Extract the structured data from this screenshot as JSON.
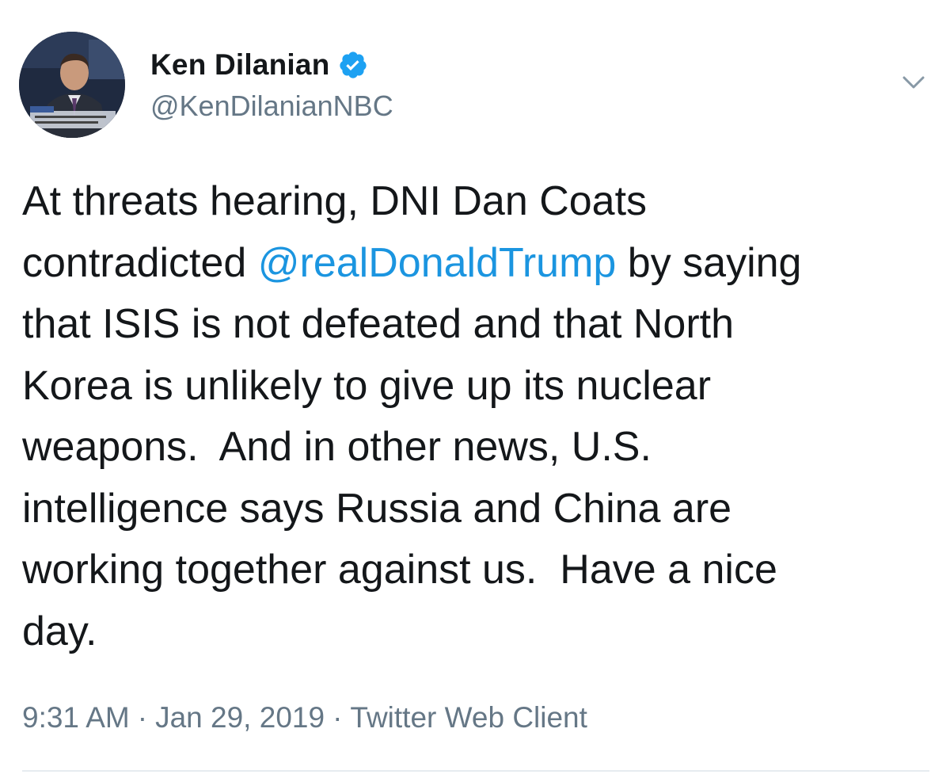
{
  "author": {
    "display_name": "Ken Dilanian",
    "handle": "@KenDilanianNBC",
    "verified": true,
    "avatar_icon": "profile-photo"
  },
  "tweet": {
    "lines": [
      {
        "parts": [
          {
            "text": "At threats hearing, DNI Dan Coats"
          }
        ]
      },
      {
        "parts": [
          {
            "text": "contradicted "
          },
          {
            "text": "@realDonaldTrump",
            "mention": true
          },
          {
            "text": " by saying"
          }
        ]
      },
      {
        "parts": [
          {
            "text": "that ISIS is not defeated and that North"
          }
        ]
      },
      {
        "parts": [
          {
            "text": "Korea is unlikely to give up its nuclear"
          }
        ]
      },
      {
        "parts": [
          {
            "text": "weapons.  And in other news, U.S."
          }
        ]
      },
      {
        "parts": [
          {
            "text": "intelligence says Russia and China are"
          }
        ]
      },
      {
        "parts": [
          {
            "text": "working together against us.  Have a nice"
          }
        ]
      },
      {
        "parts": [
          {
            "text": "day."
          }
        ]
      }
    ],
    "mention_color": "#1b95e0"
  },
  "meta": {
    "time": "9:31 AM",
    "separator": "·",
    "date": "Jan 29, 2019",
    "client": "Twitter Web Client"
  },
  "icons": {
    "verified": "verified-badge-icon",
    "more": "chevron-down-icon"
  },
  "colors": {
    "text": "#14171a",
    "secondary": "#657786",
    "accent": "#1da1f2",
    "divider": "#e6ecf0"
  }
}
